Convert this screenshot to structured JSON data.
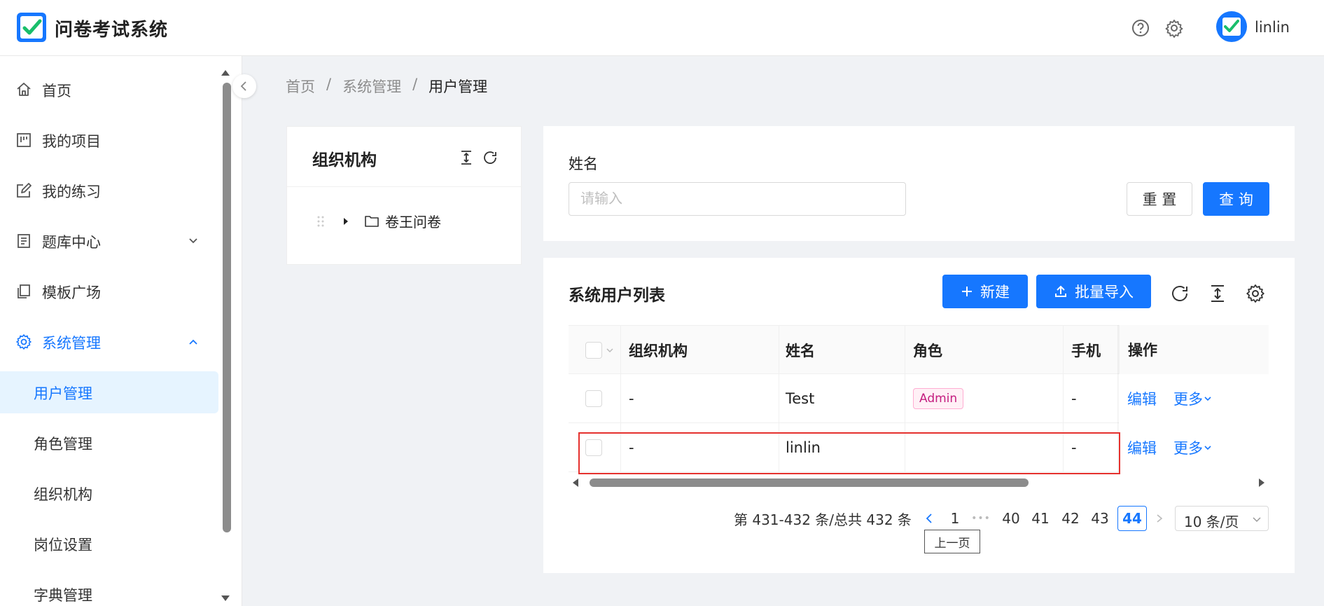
{
  "app": {
    "title": "问卷考试系统",
    "username": "linlin"
  },
  "sidebar": {
    "items": [
      {
        "label": "首页",
        "icon": "home-icon"
      },
      {
        "label": "我的项目",
        "icon": "project-icon"
      },
      {
        "label": "我的练习",
        "icon": "edit-icon"
      },
      {
        "label": "题库中心",
        "icon": "book-icon"
      },
      {
        "label": "模板广场",
        "icon": "template-icon"
      },
      {
        "label": "系统管理",
        "icon": "gear-icon"
      }
    ],
    "subitems": [
      {
        "label": "用户管理"
      },
      {
        "label": "角色管理"
      },
      {
        "label": "组织机构"
      },
      {
        "label": "岗位设置"
      },
      {
        "label": "字典管理"
      }
    ]
  },
  "breadcrumb": {
    "home": "首页",
    "sep": "/",
    "section": "系统管理",
    "current": "用户管理"
  },
  "org": {
    "title": "组织机构",
    "tree_node": "卷王问卷"
  },
  "search": {
    "name_label": "姓名",
    "name_placeholder": "请输入",
    "reset_label": "重 置",
    "query_label": "查 询"
  },
  "table": {
    "title": "系统用户列表",
    "new_label": "新建",
    "import_label": "批量导入",
    "columns": [
      "组织机构",
      "姓名",
      "角色",
      "手机",
      "操作"
    ],
    "rows": [
      {
        "org": "-",
        "name": "Test",
        "role": "Admin",
        "phone": "-",
        "edit": "编辑",
        "more": "更多"
      },
      {
        "org": "-",
        "name": "linlin",
        "role": "",
        "phone": "-",
        "edit": "编辑",
        "more": "更多"
      }
    ]
  },
  "pagination": {
    "summary": "第 431-432 条/总共 432 条",
    "first": "1",
    "ellipsis": "•••",
    "pages": [
      "40",
      "41",
      "42",
      "43"
    ],
    "current": "44",
    "page_size": "10 条/页",
    "prev_tooltip": "上一页"
  },
  "colors": {
    "primary": "#1677ff",
    "highlight": "#e5312e",
    "tag_text": "#c41d7f"
  }
}
